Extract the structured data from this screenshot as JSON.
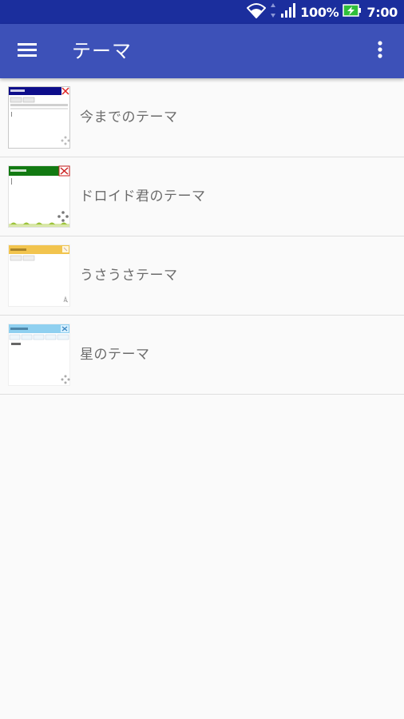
{
  "status_bar": {
    "battery": "100%",
    "time": "7:00",
    "icons": [
      "wifi-icon",
      "data-arrows-icon",
      "signal-icon",
      "battery-charging-icon"
    ]
  },
  "app_bar": {
    "title": "テーマ",
    "menu_icon": "hamburger-menu-icon",
    "overflow_icon": "more-vertical-icon",
    "color": "#3d51b8"
  },
  "themes": [
    {
      "label": "今までのテーマ",
      "thumb_header_color": "#0d0d8a"
    },
    {
      "label": "ドロイド君のテーマ",
      "thumb_header_color": "#127a12"
    },
    {
      "label": "うさうさテーマ",
      "thumb_header_color": "#f2c44e"
    },
    {
      "label": "星のテーマ",
      "thumb_header_color": "#8fd0f0"
    }
  ],
  "colors": {
    "status_bar": "#1b2e9d",
    "background": "#fafafa",
    "divider": "#dedede",
    "label_text": "#6b6b6b"
  }
}
